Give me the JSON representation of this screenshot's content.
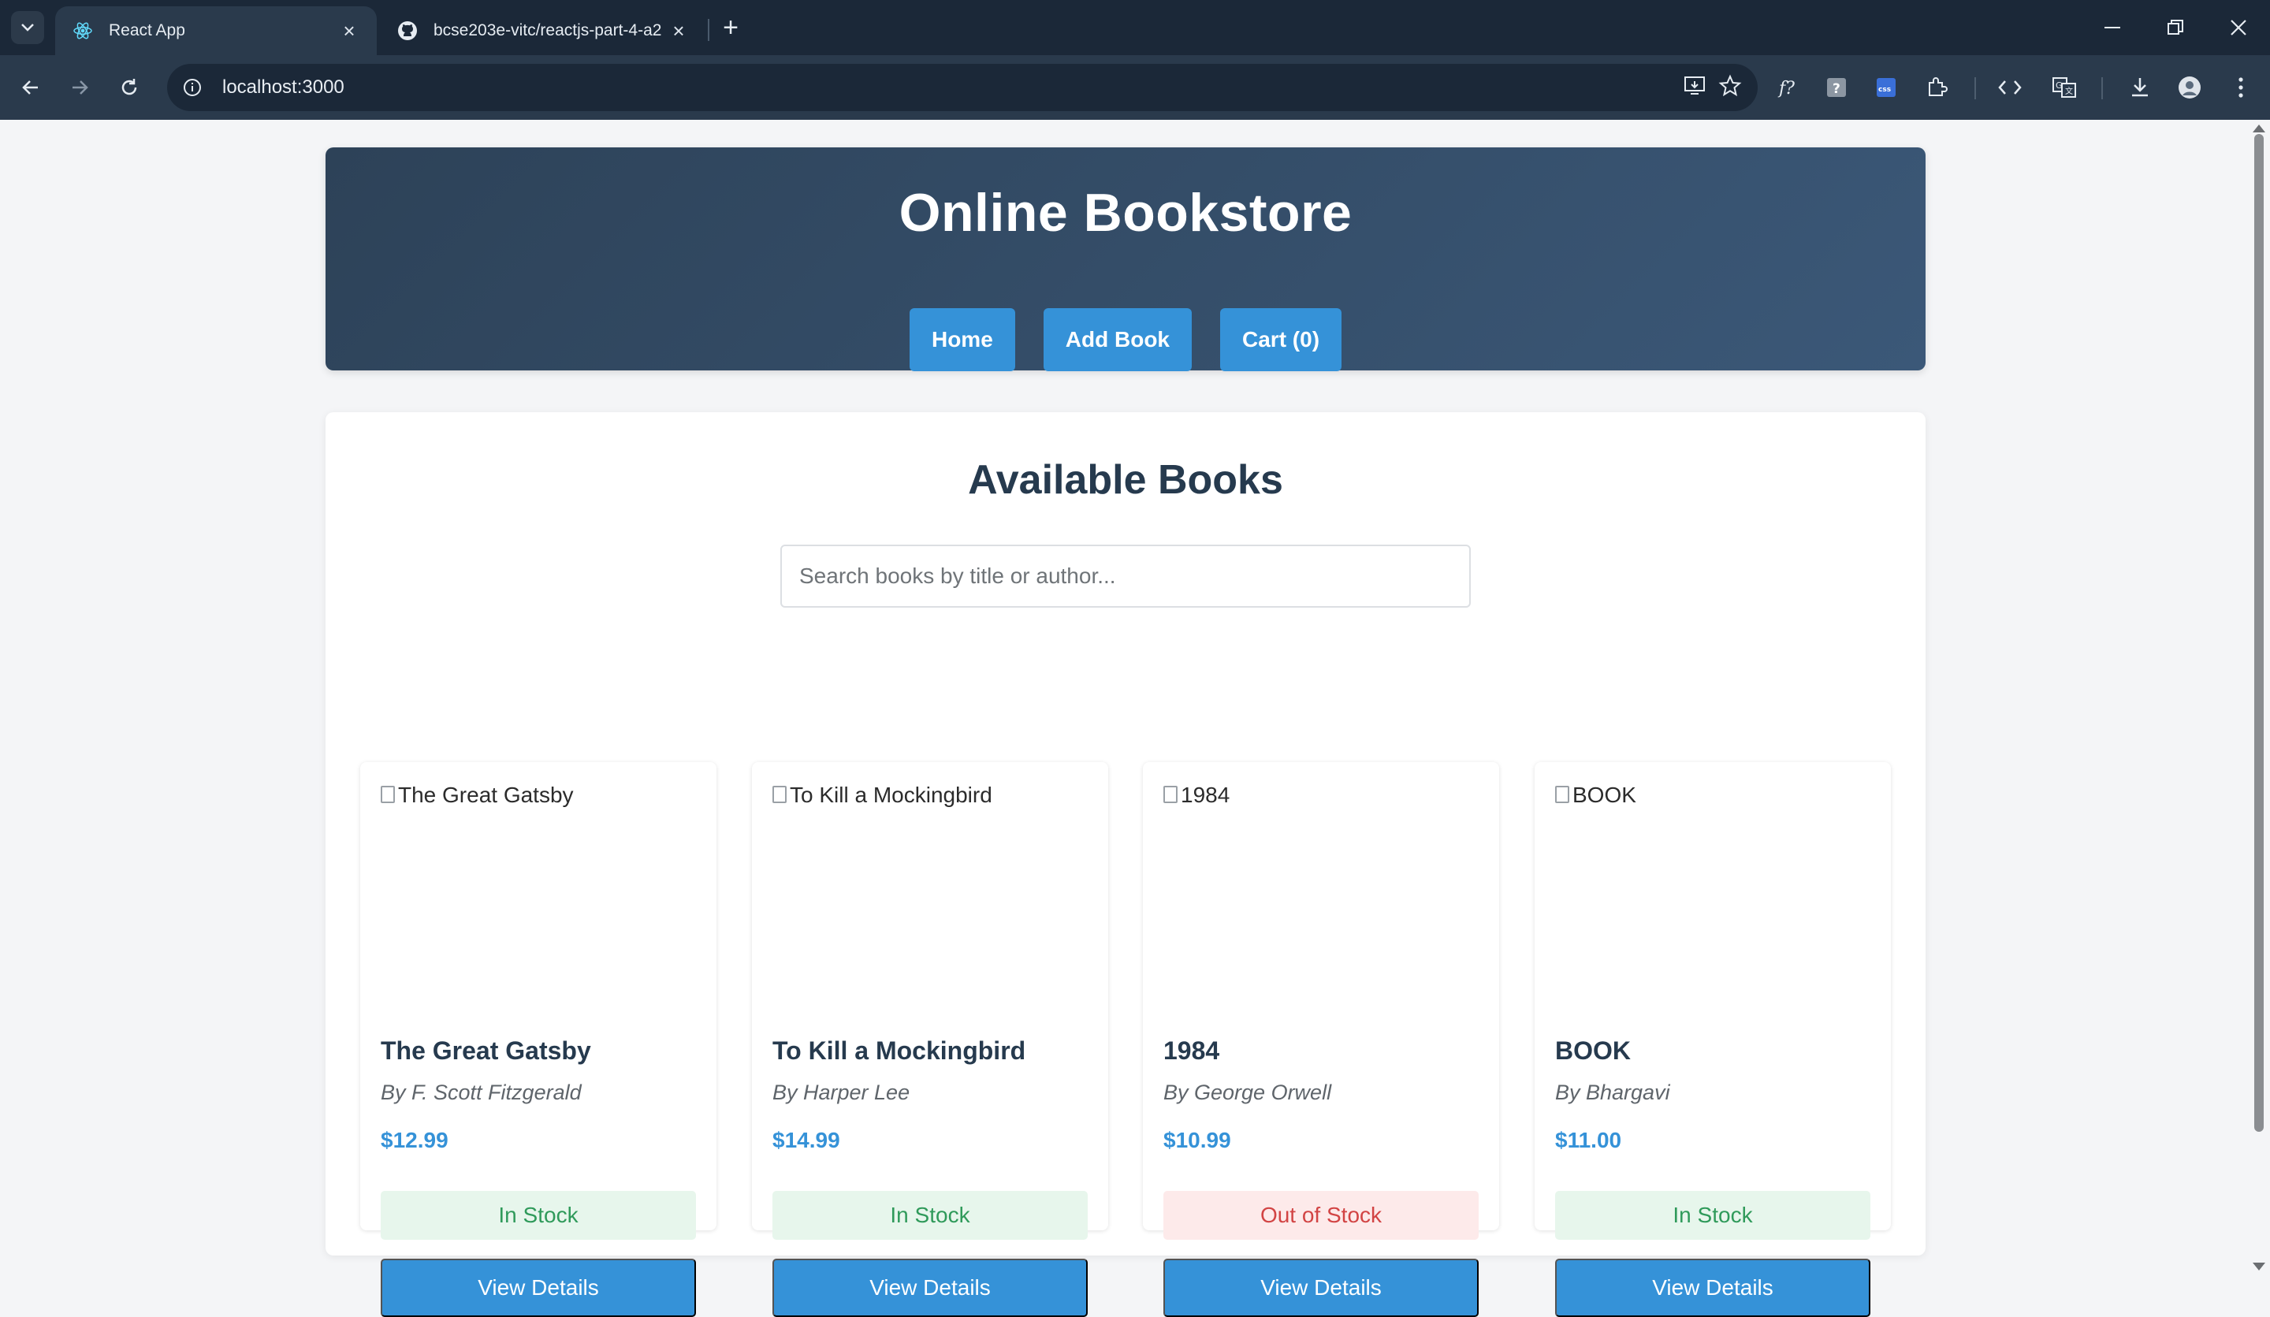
{
  "browser": {
    "tabs": [
      {
        "title": "React App",
        "active": true,
        "favicon": "react-icon"
      },
      {
        "title": "bcse203e-vitc/reactjs-part-4-a2",
        "active": false,
        "favicon": "github-icon"
      }
    ],
    "url": "localhost:3000"
  },
  "header": {
    "title": "Online Bookstore",
    "nav": [
      "Home",
      "Add Book",
      "Cart (0)"
    ]
  },
  "main": {
    "heading": "Available Books",
    "search_placeholder": "Search books by title or author..."
  },
  "books": [
    {
      "cover_alt": "The Great Gatsby",
      "title": "The Great Gatsby",
      "author": "By F. Scott Fitzgerald",
      "price": "$12.99",
      "stock": "In Stock",
      "button": "View Details"
    },
    {
      "cover_alt": "To Kill a Mockingbird",
      "title": "To Kill a Mockingbird",
      "author": "By Harper Lee",
      "price": "$14.99",
      "stock": "In Stock",
      "button": "View Details"
    },
    {
      "cover_alt": "1984",
      "title": "1984",
      "author": "By George Orwell",
      "price": "$10.99",
      "stock": "Out of Stock",
      "button": "View Details"
    },
    {
      "cover_alt": "BOOK",
      "title": "BOOK",
      "author": "By Bhargavi",
      "price": "$11.00",
      "stock": "In Stock",
      "button": "View Details"
    }
  ],
  "colors": {
    "header_gradient_start": "#2d4258",
    "header_gradient_end": "#3b5878",
    "accent": "#3592d8",
    "in_stock_text": "#2f9a5a",
    "in_stock_bg": "#e7f6ec",
    "out_of_stock_text": "#d24444",
    "out_of_stock_bg": "#fdeaea"
  }
}
